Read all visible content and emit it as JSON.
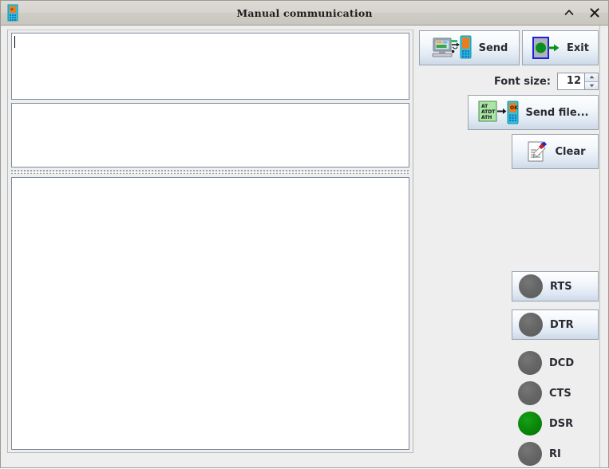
{
  "window": {
    "title": "Manual communication",
    "app_icon": "mobile-phone-icon",
    "controls": [
      {
        "name": "collapse-button",
        "glyph": "˄"
      },
      {
        "name": "close-button",
        "glyph": "✕"
      }
    ]
  },
  "editor": {
    "input_area": {
      "value": "",
      "placeholder": ""
    },
    "command_area": {
      "value": "",
      "placeholder": ""
    },
    "log_area": {
      "value": "",
      "placeholder": ""
    }
  },
  "toolbar": {
    "send_label": "Send",
    "exit_label": "Exit",
    "send_file_label": "Send file...",
    "clear_label": "Clear",
    "send_file_icon_lines": [
      "AT",
      "ATDT",
      "ATH"
    ],
    "send_file_icon_ok": "OK"
  },
  "font_size": {
    "label": "Font size:",
    "value": "12",
    "up_glyph": "▲",
    "down_glyph": "▼"
  },
  "indicators": [
    {
      "label": "RTS",
      "state": "off",
      "type": "button"
    },
    {
      "label": "DTR",
      "state": "off",
      "type": "button"
    },
    {
      "label": "DCD",
      "state": "off",
      "type": "led"
    },
    {
      "label": "CTS",
      "state": "off",
      "type": "led"
    },
    {
      "label": "DSR",
      "state": "on",
      "type": "led"
    },
    {
      "label": "RI",
      "state": "off",
      "type": "led"
    }
  ],
  "colors": {
    "led_on": "#0b8a0b",
    "led_off": "#666666",
    "window_bg": "#eeeeee",
    "titlebar_bg": "#d4d1cb",
    "field_border": "#7d8a9c"
  }
}
